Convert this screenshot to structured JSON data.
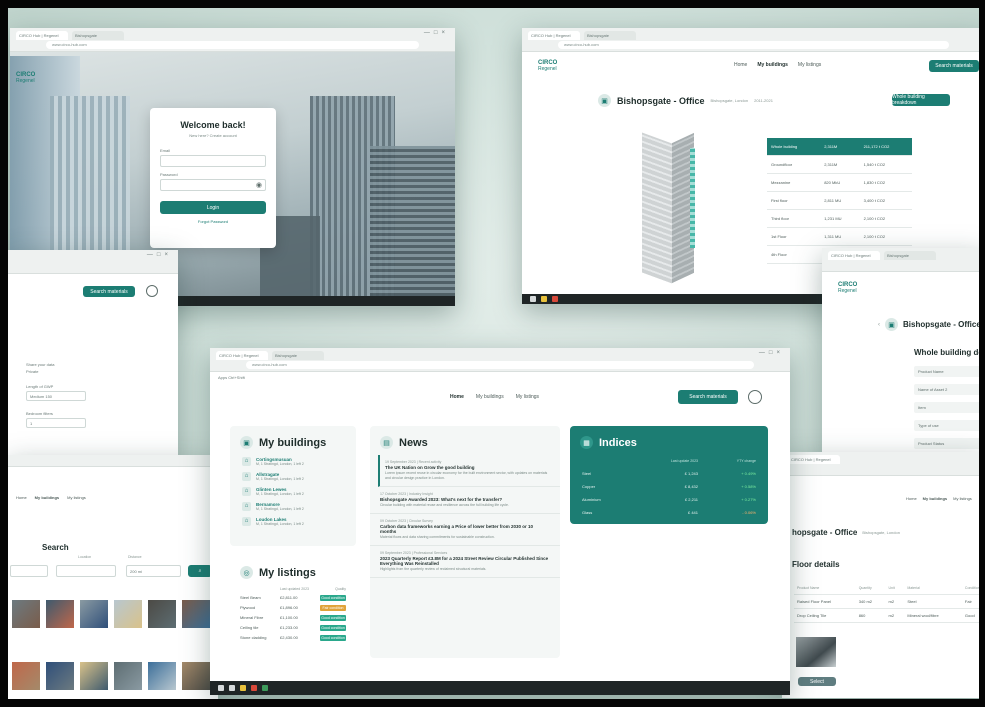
{
  "login": {
    "title": "Welcome back!",
    "subtitle": "New here? Create account",
    "email_label": "Email",
    "password_label": "Password",
    "login_button": "Login",
    "forgot_link": "Forgot Password"
  },
  "nav": {
    "home": "Home",
    "my_buildings": "My buildings",
    "my_listings": "My listings",
    "search_button": "Search materials"
  },
  "brand": {
    "logo_top": "CIRCO",
    "logo_bottom": "Regenel"
  },
  "building_view": {
    "title": "Bishopsgate - Office",
    "meta_1": "Bishopsgate, London",
    "meta_2": "2011-2021",
    "action_button": "Whole building breakdown",
    "table": [
      [
        "Whole building",
        "2,311M",
        "211,172 t CO2"
      ],
      [
        "Groundfloor",
        "2,311M",
        "1,540 t CO2"
      ],
      [
        "Mezzanine",
        "820 MkU",
        "1,830 t CO2"
      ],
      [
        "First floor",
        "2,811 MU",
        "3,400 t CO2"
      ],
      [
        "Third floor",
        "1,231 MU",
        "2,100 t CO2"
      ],
      [
        "1st Floor",
        "1,311 MU",
        "2,100 t CO2"
      ],
      [
        "4th Floor",
        "",
        ""
      ]
    ]
  },
  "dashboard": {
    "my_buildings": {
      "title": "My buildings",
      "items": [
        {
          "name": "Cortingsmusuan",
          "sub": "M, 1 Stratingd, London, 1 left 2"
        },
        {
          "name": "Allstragate",
          "sub": "M, 1 Stratingd, London, 1 left 2"
        },
        {
          "name": "Glinten Lewes",
          "sub": "M, 1 Stratingd, London, 1 left 2"
        },
        {
          "name": "Bernamore",
          "sub": "M, 1 Stratingd, London, 1 left 2"
        },
        {
          "name": "Loudon Lakes",
          "sub": "M, 1 Stratingd, London, 1 left 2"
        }
      ]
    },
    "news": {
      "title": "News",
      "items": [
        {
          "date": "19 September 2023 | Recent activity",
          "title": "The UK Nation on Grow the good building",
          "body": "Lorem ipsum recent reuse in circular economy for the built environment sector, with updates on materials and circular design practice in London."
        },
        {
          "date": "17 October 2023 | Industry Insight",
          "title": "Bishopsgate Awarded 2023: What's next for the transfer?",
          "body": "Circular building with material reuse and resilience across the full building life cycle."
        },
        {
          "date": "09 October 2023 | Circular Survey",
          "title": "Carbon data frameworks earning a Price of lower better from 2030 or 10 months",
          "body": "Material flows and data sharing commitments for sustainable construction."
        },
        {
          "date": "09 September 2023 | Professional Services",
          "title": "2023 Quarterly Report £3.8M for a 2024 Street Review Circular Published Since Everything Was Reinstalled",
          "body": "Highlights from the quarterly review of reclaimed structural materials."
        }
      ]
    },
    "indices": {
      "title": "Indices",
      "col_1": "Last update 2023",
      "col_2": "YTY change",
      "rows": [
        {
          "name": "Steel",
          "val": "£ 1,243",
          "chg": "+ 0.49%",
          "neg": false
        },
        {
          "name": "Copper",
          "val": "£ 8,432",
          "chg": "+ 0.58%",
          "neg": false
        },
        {
          "name": "Aluminium",
          "val": "£ 2,211",
          "chg": "+ 0.27%",
          "neg": false
        },
        {
          "name": "Glass",
          "val": "£ 441",
          "chg": "- 0.06%",
          "neg": true
        }
      ]
    },
    "my_listings": {
      "title": "My listings",
      "col_1": "Last updated 2023",
      "col_2": "Quality",
      "rows": [
        {
          "name": "Steel Beam",
          "val": "£2,811.00",
          "tag": "Good condition",
          "color": "#2aa88c"
        },
        {
          "name": "Plywood",
          "val": "£1,896.00",
          "tag": "Fair condition",
          "color": "#e0a33a"
        },
        {
          "name": "Mineral Fibre",
          "val": "£1,100.00",
          "tag": "Good condition",
          "color": "#2aa88c"
        },
        {
          "name": "Ceiling tile",
          "val": "£1,233.00",
          "tag": "Good condition",
          "color": "#2aa88c"
        },
        {
          "name": "Stone cladding",
          "val": "£2,430.00",
          "tag": "Good condition",
          "color": "#2aa88c"
        }
      ]
    }
  },
  "details_view": {
    "title": "Bishopsgate - Office",
    "heading": "Whole building details",
    "fields": [
      "Product Name",
      "Name of Asset 2",
      "Item",
      "Type of use",
      "Product Status"
    ]
  },
  "floor_view": {
    "title": "hopsgate - Office",
    "heading": "Floor details",
    "headers": [
      "Product Name",
      "Quantity",
      "Unit",
      "Material",
      "Condition"
    ],
    "rows": [
      [
        "Raised Floor Panel",
        "340 m2",
        "m2",
        "Steel",
        "Fair"
      ],
      [
        "Drop Ceiling Tile",
        "860",
        "m2",
        "Mineral wool/fibre",
        "Good"
      ]
    ],
    "select_button": "Select"
  },
  "search_view": {
    "tabs": [
      "Home",
      "My buildings",
      "My listings"
    ],
    "heading": "Search",
    "location_label": "Location",
    "distance_label": "Distance",
    "distance_value": "200 mi"
  },
  "settings_view": {
    "search_button": "Search materials",
    "label_1": "Share your data",
    "value_1": "Private",
    "label_2": "Length of GWP",
    "value_2": "Medium 150",
    "label_3": "Bedroom filters",
    "value_3": "1"
  },
  "browser": {
    "tab_1": "CIRCO Hub | Regenel",
    "tab_2": "Bishopsgate",
    "url": "www.circo-hub.com",
    "bookmarks": "Apps  Ctrl+Shift"
  }
}
